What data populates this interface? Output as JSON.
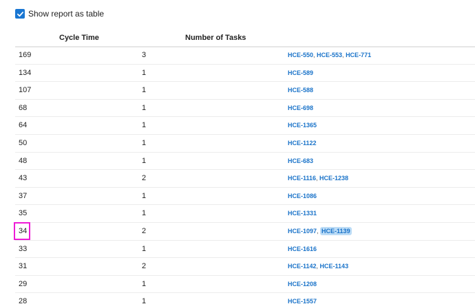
{
  "toggle": {
    "label": "Show report as table",
    "checked": true
  },
  "columns": {
    "cycle_time": "Cycle Time",
    "num_tasks": "Number of Tasks"
  },
  "colors": {
    "checkbox": "#1976d2",
    "link": "#1a73c9",
    "highlight": "#bcdcf6",
    "annotation": "#ee1bd6"
  },
  "rows": [
    {
      "cycle_time": "169",
      "count": "3",
      "tasks": [
        "HCE-550",
        "HCE-553",
        "HCE-771"
      ]
    },
    {
      "cycle_time": "134",
      "count": "1",
      "tasks": [
        "HCE-589"
      ]
    },
    {
      "cycle_time": "107",
      "count": "1",
      "tasks": [
        "HCE-588"
      ]
    },
    {
      "cycle_time": "68",
      "count": "1",
      "tasks": [
        "HCE-698"
      ]
    },
    {
      "cycle_time": "64",
      "count": "1",
      "tasks": [
        "HCE-1365"
      ]
    },
    {
      "cycle_time": "50",
      "count": "1",
      "tasks": [
        "HCE-1122"
      ]
    },
    {
      "cycle_time": "48",
      "count": "1",
      "tasks": [
        "HCE-683"
      ]
    },
    {
      "cycle_time": "43",
      "count": "2",
      "tasks": [
        "HCE-1116",
        "HCE-1238"
      ]
    },
    {
      "cycle_time": "37",
      "count": "1",
      "tasks": [
        "HCE-1086"
      ]
    },
    {
      "cycle_time": "35",
      "count": "1",
      "tasks": [
        "HCE-1331"
      ]
    },
    {
      "cycle_time": "34",
      "count": "2",
      "tasks": [
        "HCE-1097",
        "HCE-1139"
      ],
      "highlighted_task": "HCE-1139",
      "annotated": true
    },
    {
      "cycle_time": "33",
      "count": "1",
      "tasks": [
        "HCE-1616"
      ]
    },
    {
      "cycle_time": "31",
      "count": "2",
      "tasks": [
        "HCE-1142",
        "HCE-1143"
      ]
    },
    {
      "cycle_time": "29",
      "count": "1",
      "tasks": [
        "HCE-1208"
      ]
    },
    {
      "cycle_time": "28",
      "count": "1",
      "tasks": [
        "HCE-1557"
      ]
    }
  ]
}
